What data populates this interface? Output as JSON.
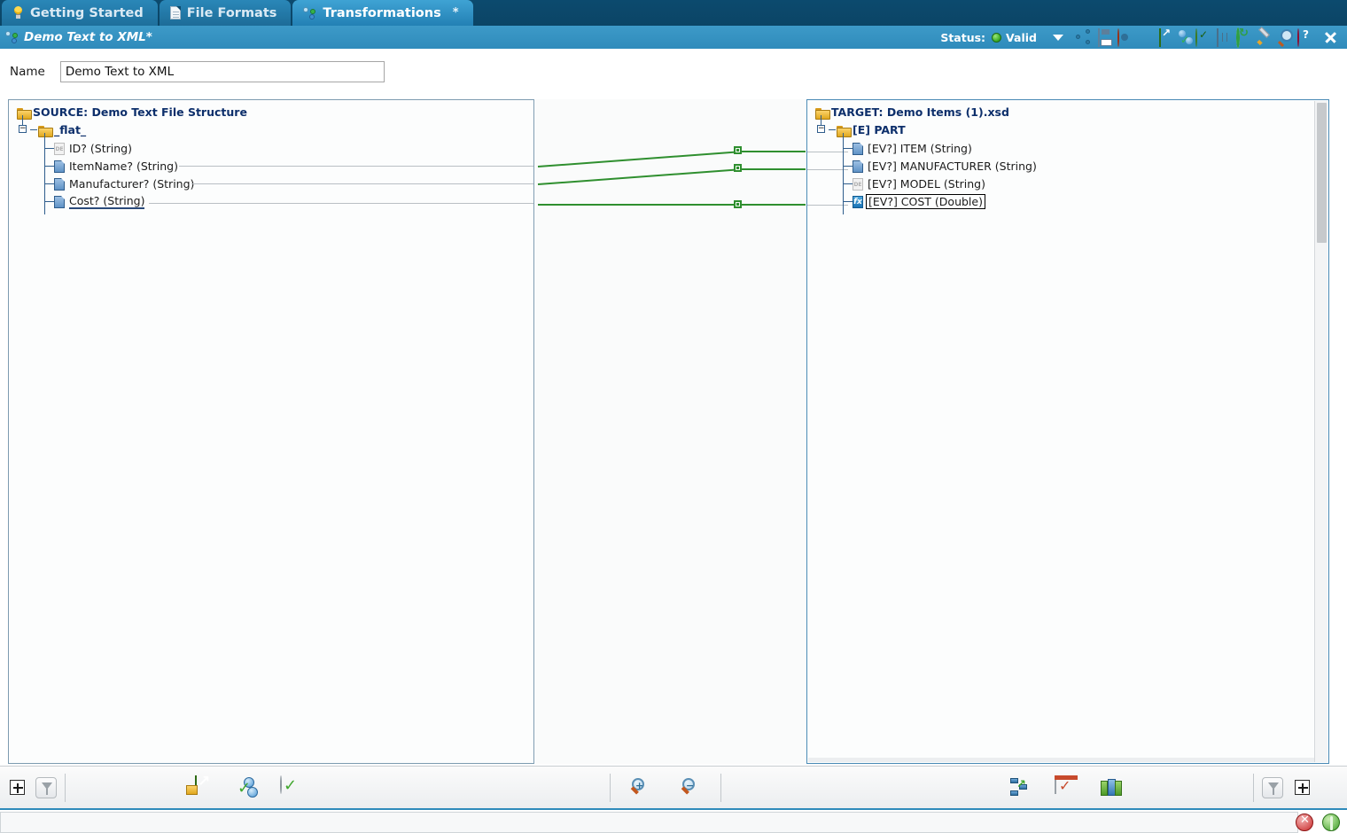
{
  "tabs": [
    {
      "label": "Getting Started",
      "icon": "bulb-icon",
      "active": false,
      "modified": ""
    },
    {
      "label": "File Formats",
      "icon": "document-icon",
      "active": false,
      "modified": ""
    },
    {
      "label": "Transformations",
      "icon": "transformation-icon",
      "active": true,
      "modified": "*"
    }
  ],
  "titlebar": {
    "document_title": "Demo Text to XML*",
    "status_label": "Status:",
    "status_value": "Valid",
    "status_color": "#3fae27",
    "icons": [
      "share-nodes-icon",
      "save-icon",
      "lifering-icon",
      "orb-icon",
      "export-green-icon",
      "blue-spheres-icon",
      "circle-check-icon",
      "table-icon",
      "refresh-icon",
      "wrench-icon",
      "magnifier-icon",
      "help-icon",
      "close-icon"
    ]
  },
  "name_field": {
    "label": "Name",
    "value": "Demo Text to XML",
    "placeholder": ""
  },
  "source_panel": {
    "title": "SOURCE: Demo Text File Structure",
    "root": "_flat_",
    "fields": [
      {
        "label": "ID? (String)",
        "icon": "data-element-grey-icon",
        "mapped": false,
        "selected": false
      },
      {
        "label": "ItemName? (String)",
        "icon": "data-element-blue-icon",
        "mapped": true,
        "selected": false
      },
      {
        "label": "Manufacturer? (String)",
        "icon": "data-element-blue-icon",
        "mapped": true,
        "selected": false
      },
      {
        "label": "Cost? (String)",
        "icon": "data-element-blue-icon",
        "mapped": true,
        "selected": true
      }
    ]
  },
  "target_panel": {
    "title": "TARGET: Demo Items (1).xsd",
    "root": "[E] PART",
    "fields": [
      {
        "label": "[EV?] ITEM  (String)",
        "icon": "data-element-blue-icon",
        "mapped": true,
        "selected": false
      },
      {
        "label": "[EV?] MANUFACTURER  (String)",
        "icon": "data-element-blue-icon",
        "mapped": true,
        "selected": false
      },
      {
        "label": "[EV?] MODEL  (String)",
        "icon": "data-element-grey-icon",
        "mapped": false,
        "selected": false
      },
      {
        "label": "[EV?] COST  (Double)",
        "icon": "function-fx-icon",
        "mapped": true,
        "selected": true
      }
    ]
  },
  "links": {
    "color": "#2f8f2f",
    "connections": [
      {
        "from": "ItemName? (String)",
        "to": "[EV?] ITEM  (String)"
      },
      {
        "from": "Manufacturer? (String)",
        "to": "[EV?] MANUFACTURER  (String)"
      },
      {
        "from": "Cost? (String)",
        "to": "[EV?] COST  (Double)"
      }
    ]
  },
  "bottom_toolbar": {
    "left": [
      "add-icon",
      "filter-icon"
    ],
    "left_actions": [
      "export-mapping-icon",
      "link-objects-icon",
      "validate-mapping-icon"
    ],
    "zoom": [
      "zoom-in-icon",
      "zoom-out-icon"
    ],
    "right_actions": [
      "flow-diagram-icon",
      "validate-icon",
      "database-icon"
    ],
    "right": [
      "filter-icon",
      "add-icon"
    ]
  },
  "footer": {
    "message": "",
    "icons": [
      "error-status-icon",
      "connection-status-icon"
    ]
  }
}
